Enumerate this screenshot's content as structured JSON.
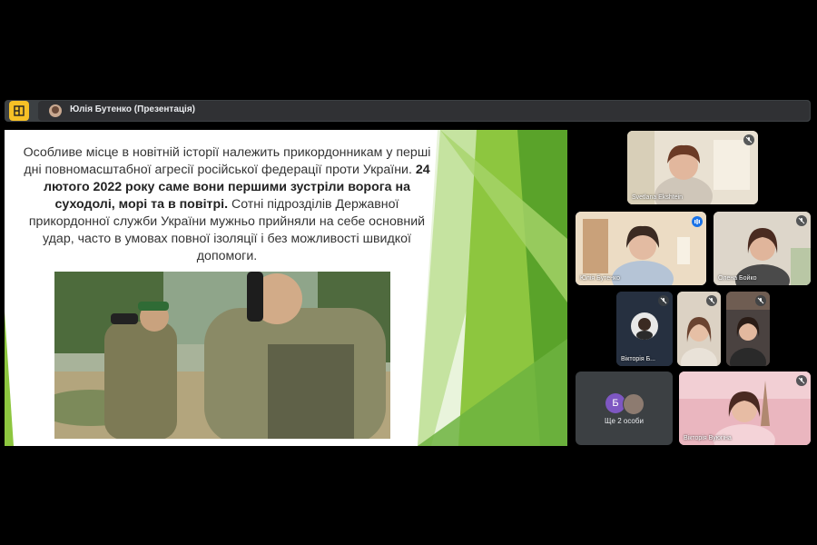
{
  "presenter_bar": {
    "label": "Юлія Бутенко (Презентація)"
  },
  "slide": {
    "paragraph_part1": "Особливе місце в новітній історії належить прикордонникам у перші дні повномасштабної агресії російської федерації проти України.",
    "paragraph_bold": "24 лютого 2022 року саме вони першими зустріли ворога на суходолі, морі та в повітрі.",
    "paragraph_part2": "Сотні підрозділів Державної прикордонної служби України мужньо прийняли на себе основний удар, часто в умовах повної ізоляції і без можливості швидкої допомоги.",
    "accent_colors": [
      "#8dc63f",
      "#5aa32a",
      "#c5e3a0"
    ]
  },
  "participants": [
    {
      "name": "Svetlana Ekshtein",
      "mic": "muted"
    },
    {
      "name": "Юлія Бутенко",
      "mic": "speaking"
    },
    {
      "name": "Олена Бойко",
      "mic": "muted"
    },
    {
      "name": "Вікторія Б...",
      "mic": "muted"
    },
    {
      "name": "",
      "mic": "muted"
    },
    {
      "name": "",
      "mic": "muted"
    },
    {
      "name": "Вікторія Вуюгіна",
      "mic": "muted"
    }
  ],
  "others": {
    "label": "Ще 2 особи",
    "avatar_letter": "Б"
  }
}
